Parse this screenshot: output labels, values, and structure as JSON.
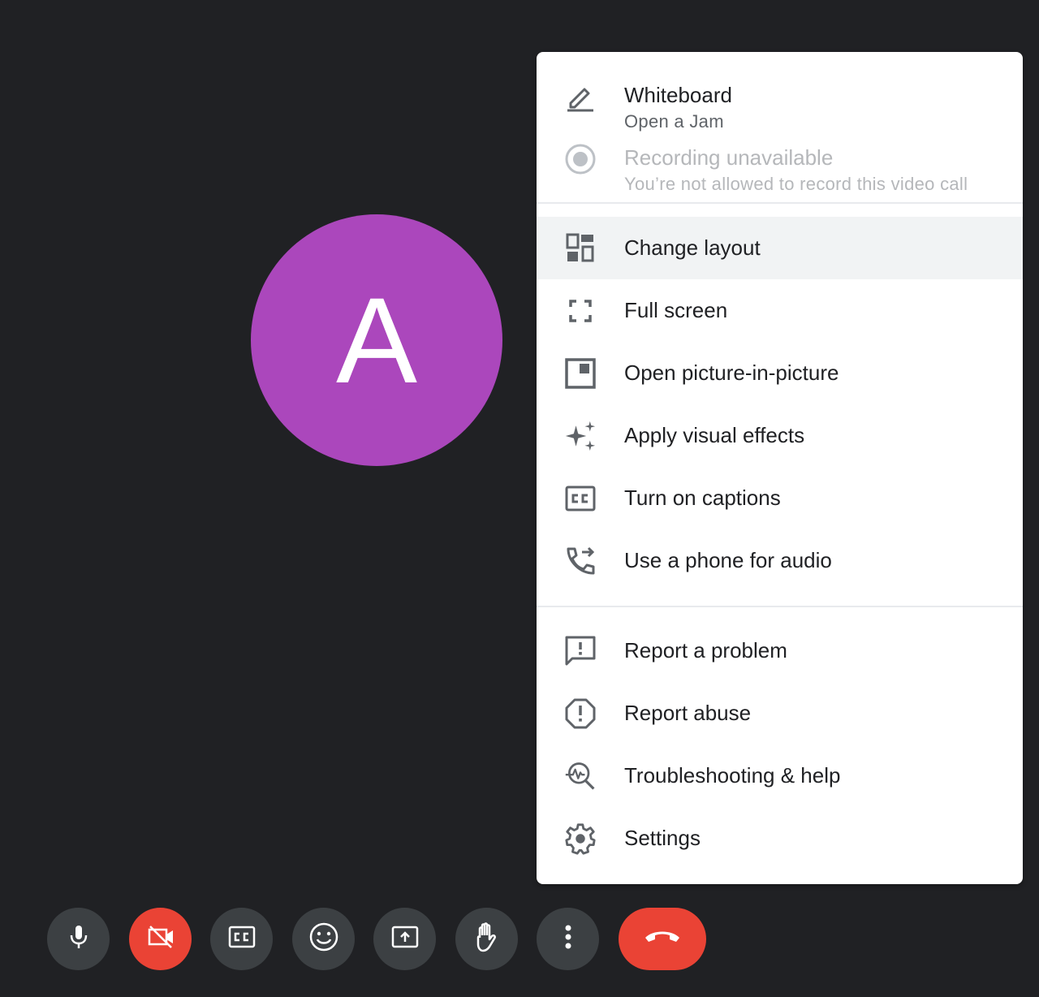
{
  "avatar": {
    "initial": "A",
    "color": "#ab47bc"
  },
  "menu": {
    "whiteboard": {
      "title": "Whiteboard",
      "subtitle": "Open a Jam",
      "icon": "pen-icon"
    },
    "recording": {
      "title": "Recording unavailable",
      "subtitle": "You’re not allowed to record this video call",
      "icon": "record-icon",
      "disabled": true
    },
    "items": [
      {
        "label": "Change layout",
        "icon": "layout-icon",
        "highlighted": true
      },
      {
        "label": "Full screen",
        "icon": "fullscreen-icon"
      },
      {
        "label": "Open picture-in-picture",
        "icon": "picture-in-picture-icon"
      },
      {
        "label": "Apply visual effects",
        "icon": "sparkle-icon"
      },
      {
        "label": "Turn on captions",
        "icon": "captions-icon"
      },
      {
        "label": "Use a phone for audio",
        "icon": "phone-forward-icon"
      }
    ],
    "help_items": [
      {
        "label": "Report a problem",
        "icon": "feedback-icon"
      },
      {
        "label": "Report abuse",
        "icon": "report-icon"
      },
      {
        "label": "Troubleshooting & help",
        "icon": "troubleshoot-icon"
      },
      {
        "label": "Settings",
        "icon": "gear-icon"
      }
    ]
  },
  "toolbar": {
    "buttons": [
      {
        "name": "microphone",
        "icon": "mic-icon"
      },
      {
        "name": "camera",
        "icon": "camera-off-icon",
        "state": "off",
        "color": "#ea4335"
      },
      {
        "name": "captions",
        "icon": "captions-icon"
      },
      {
        "name": "reactions",
        "icon": "emoji-icon"
      },
      {
        "name": "present",
        "icon": "present-screen-icon"
      },
      {
        "name": "raise-hand",
        "icon": "hand-icon"
      },
      {
        "name": "more-options",
        "icon": "more-vert-icon"
      },
      {
        "name": "leave-call",
        "icon": "hangup-icon",
        "color": "#ea4335"
      }
    ]
  }
}
